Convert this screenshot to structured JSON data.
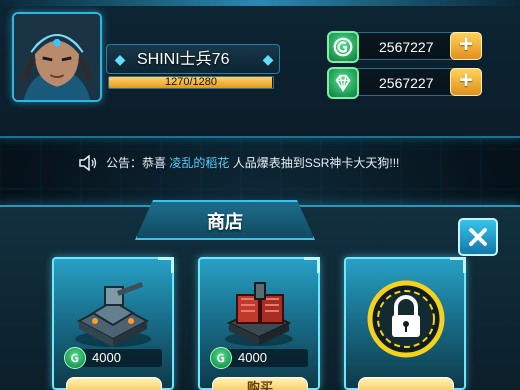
{
  "player": {
    "name": "SHINI士兵76",
    "exp_text": "1270/1280",
    "exp_fraction": 0.992
  },
  "currencies": [
    {
      "name": "gold-coin",
      "value": "2567227"
    },
    {
      "name": "diamond",
      "value": "2567227"
    }
  ],
  "announcement": {
    "prefix": "公告：恭喜 ",
    "highlight": "凌乱的稻花",
    "suffix": " 人品爆表抽到SSR神卡大天狗!!!"
  },
  "shop": {
    "title": "商店",
    "items": [
      {
        "icon": "turret-building-icon",
        "price": "4000",
        "button": ""
      },
      {
        "icon": "red-turret-icon",
        "price": "4000",
        "button": "购买"
      },
      {
        "icon": "padlock-icon",
        "price": "",
        "button": ""
      }
    ]
  },
  "colors": {
    "accent": "#2fb6e2",
    "highlight_text": "#52d0ff",
    "gold_button": "#e0901c",
    "currency_green": "#0f7a3d"
  }
}
